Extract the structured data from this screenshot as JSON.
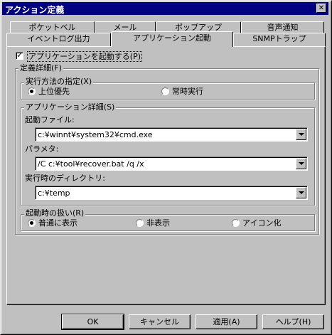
{
  "window": {
    "title": "アクション定義",
    "close_glyph": "✕"
  },
  "tabs_row1": [
    "ポケットベル",
    "メール",
    "ポップアップ",
    "音声通知"
  ],
  "tabs_row2": [
    "イベントログ出力",
    "アプリケーション起動",
    "SNMPトラップ"
  ],
  "active_tab": "アプリケーション起動",
  "launch_checkbox": {
    "label": "アプリケーションを起動する(P)",
    "checked": true
  },
  "definition_group": {
    "label": "定義詳細(F)"
  },
  "exec_method": {
    "label": "実行方法の指定(X)",
    "options": [
      "上位優先",
      "常時実行"
    ],
    "selected": 0
  },
  "app_detail": {
    "label": "アプリケーション詳細(S)",
    "file_label": "起動ファイル:",
    "file_value": "c:¥winnt¥system32¥cmd.exe",
    "param_label": "パラメタ:",
    "param_value": "/C c:¥tool¥recover.bat /q /x",
    "dir_label": "実行時のディレクトリ:",
    "dir_value": "c:¥temp"
  },
  "startup": {
    "label": "起動時の扱い(R)",
    "options": [
      "普通に表示",
      "非表示",
      "アイコン化"
    ],
    "selected": 0
  },
  "buttons": {
    "ok": "OK",
    "cancel": "キャンセル",
    "apply": "適用(A)",
    "help": "ヘルプ(H)"
  }
}
